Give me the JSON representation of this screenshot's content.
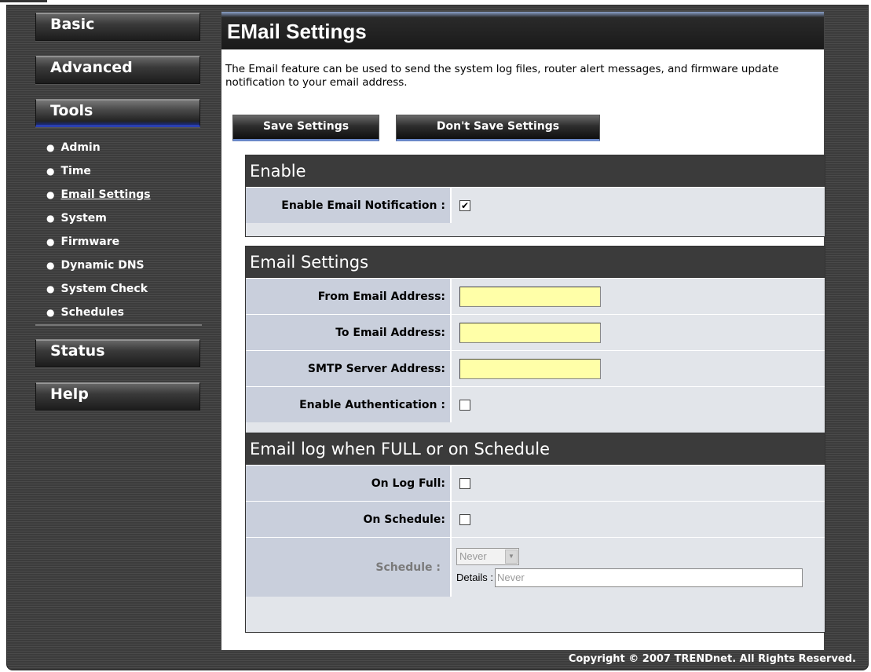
{
  "nav": {
    "basic": "Basic",
    "advanced": "Advanced",
    "tools": "Tools",
    "status": "Status",
    "help": "Help",
    "tools_items": [
      {
        "label": "Admin"
      },
      {
        "label": "Time"
      },
      {
        "label": "Email Settings"
      },
      {
        "label": "System"
      },
      {
        "label": "Firmware"
      },
      {
        "label": "Dynamic DNS"
      },
      {
        "label": "System Check"
      },
      {
        "label": "Schedules"
      }
    ]
  },
  "page": {
    "title": "EMail Settings",
    "intro": "The Email feature can be used to send the system log files, router alert messages, and firmware update notification to your email address."
  },
  "buttons": {
    "save": "Save Settings",
    "dont_save": "Don't Save Settings"
  },
  "enable_section": {
    "title": "Enable",
    "enable_label": "Enable Email Notification :",
    "enable_checked": true
  },
  "email_section": {
    "title": "Email Settings",
    "from_label": "From Email Address:",
    "from_value": "",
    "to_label": "To Email Address:",
    "to_value": "",
    "smtp_label": "SMTP Server Address:",
    "smtp_value": "",
    "auth_label": "Enable Authentication :",
    "auth_checked": false
  },
  "log_section": {
    "title": "Email log when FULL or on Schedule",
    "logfull_label": "On Log Full:",
    "logfull_checked": false,
    "onschedule_label": "On Schedule:",
    "onschedule_checked": false,
    "schedule_label": "Schedule :",
    "schedule_value": "Never",
    "details_label": "Details :",
    "details_value": "Never"
  },
  "footer": "Copyright © 2007 TRENDnet. All Rights Reserved.",
  "colors": {
    "input_bg": "#ffffa8",
    "label_cell_bg": "#c9cfdc",
    "section_head_bg": "#3b3b3b",
    "accent": "#2a3fb0"
  },
  "icons": {
    "bullet": "bullet-dot-icon",
    "checkmark": "checkmark-icon",
    "dropdown_arrow": "chevron-down-icon"
  }
}
